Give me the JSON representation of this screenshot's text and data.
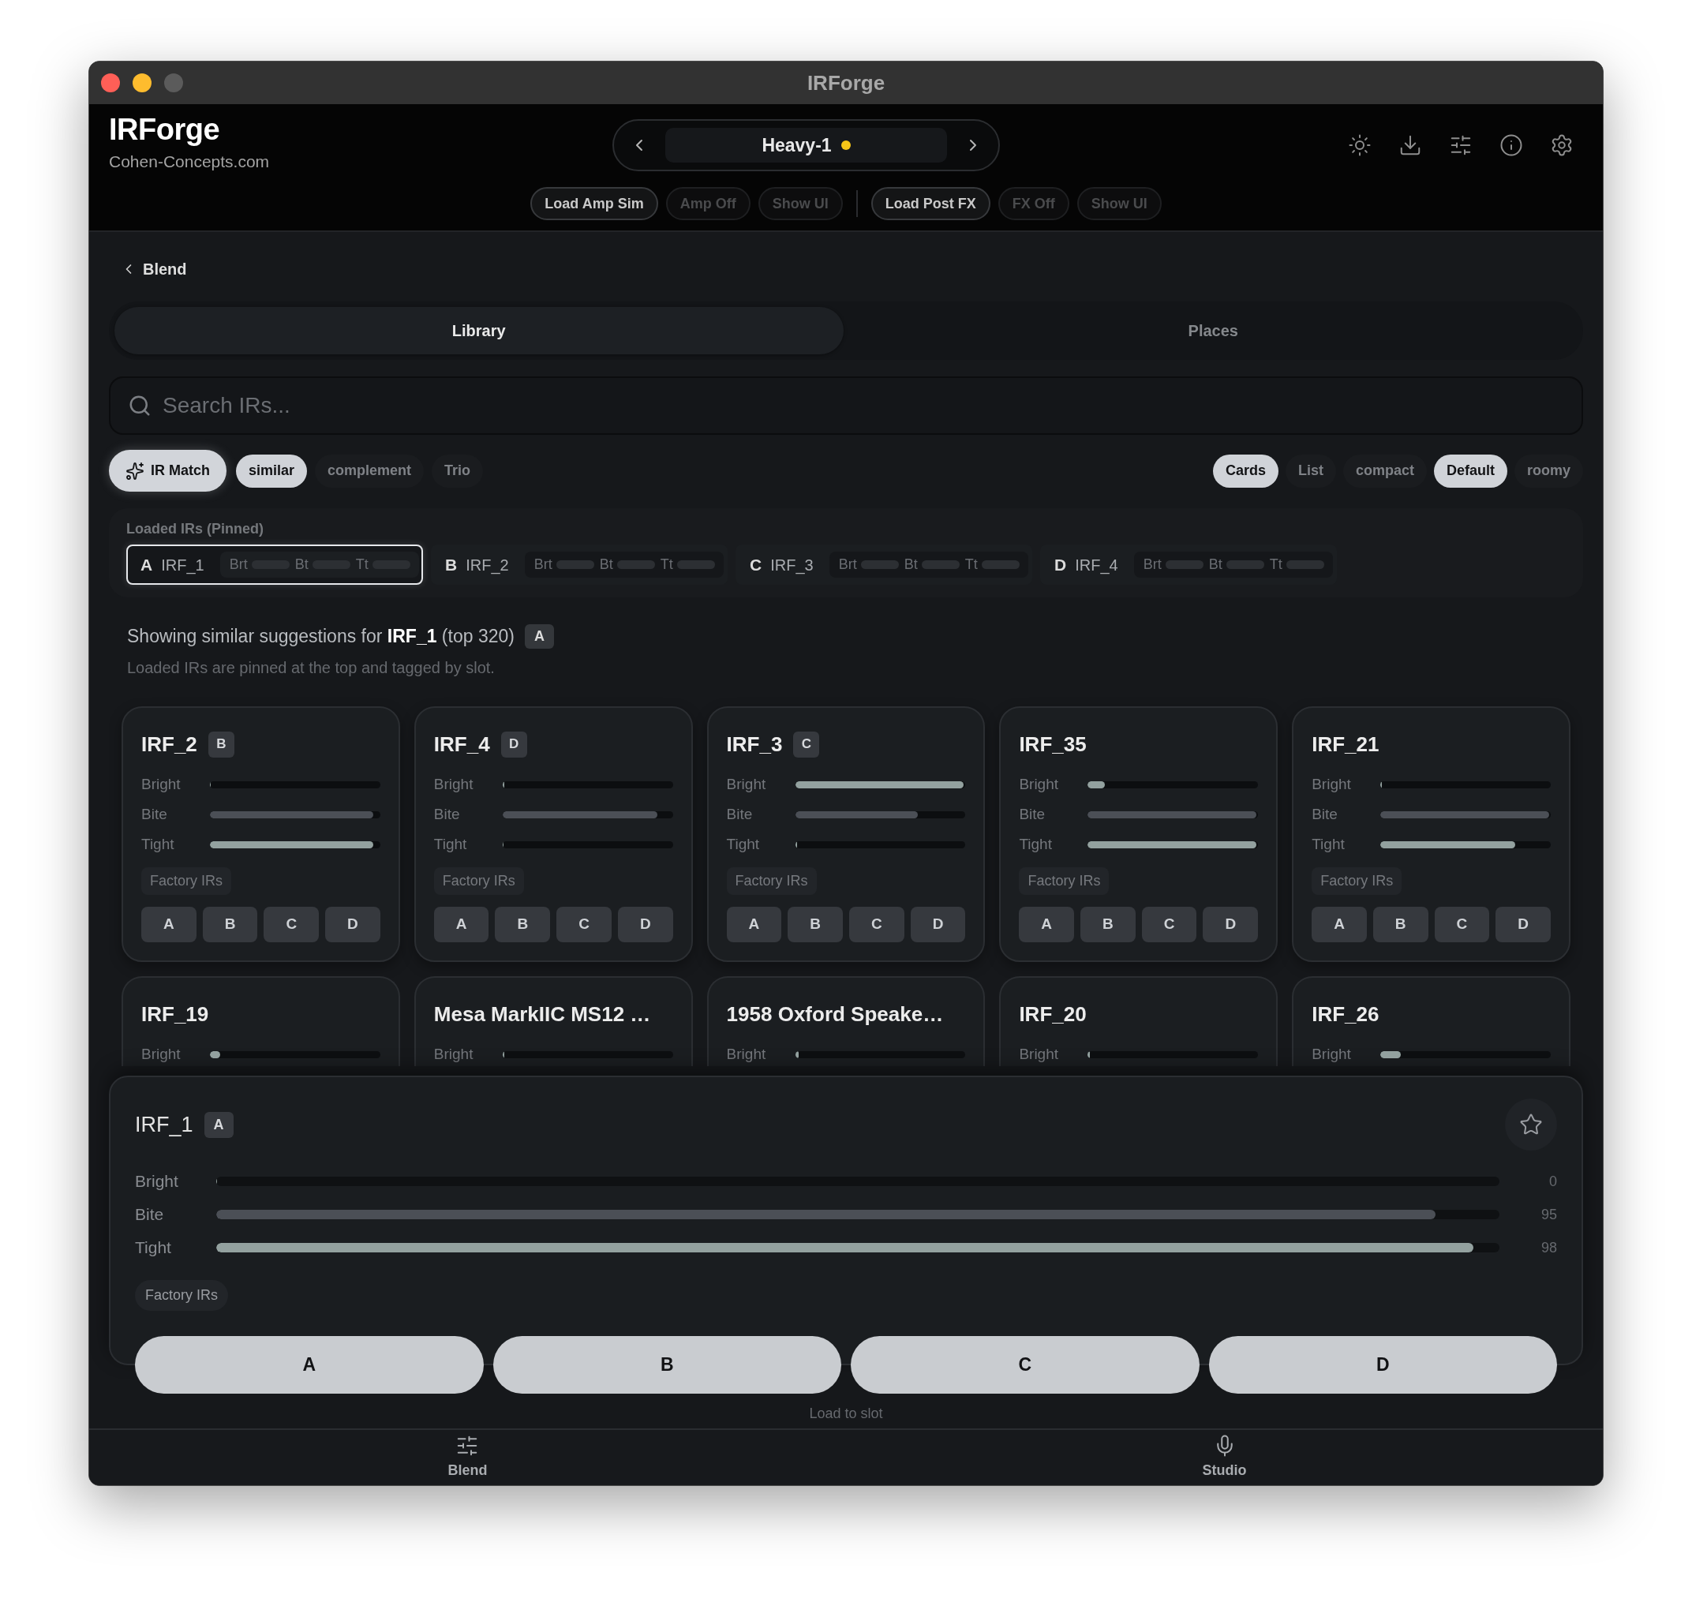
{
  "window": {
    "title": "IRForge"
  },
  "header": {
    "app_name": "IRForge",
    "site": "Cohen-Concepts.com",
    "preset": {
      "name": "Heavy-1",
      "modified": true
    },
    "action_groups": [
      {
        "actions": [
          {
            "label": "Load Amp Sim",
            "disabled": false
          },
          {
            "label": "Amp Off",
            "disabled": true
          },
          {
            "label": "Show UI",
            "disabled": true
          }
        ]
      },
      {
        "actions": [
          {
            "label": "Load Post FX",
            "disabled": false
          },
          {
            "label": "FX Off",
            "disabled": true
          },
          {
            "label": "Show UI",
            "disabled": true
          }
        ]
      }
    ]
  },
  "back": {
    "label": "Blend"
  },
  "tabs": [
    {
      "label": "Library",
      "selected": true
    },
    {
      "label": "Places",
      "selected": false
    }
  ],
  "search": {
    "placeholder": "Search IRs..."
  },
  "ir_match": {
    "label": "IR Match",
    "on": true
  },
  "match_modes": [
    {
      "label": "similar",
      "selected": true
    },
    {
      "label": "complement",
      "selected": false
    },
    {
      "label": "Trio",
      "selected": false
    }
  ],
  "view_modes": [
    {
      "label": "Cards",
      "selected": true
    },
    {
      "label": "List",
      "selected": false
    }
  ],
  "density": [
    {
      "label": "compact",
      "selected": false
    },
    {
      "label": "Default",
      "selected": true
    },
    {
      "label": "roomy",
      "selected": false
    }
  ],
  "pinned": {
    "title": "Loaded IRs (Pinned)",
    "items": [
      {
        "slot": "A",
        "name": "IRF_1",
        "selected": true,
        "meters": [
          "Brt",
          "Bt",
          "Tt"
        ]
      },
      {
        "slot": "B",
        "name": "IRF_2",
        "selected": false,
        "meters": [
          "Brt",
          "Bt",
          "Tt"
        ]
      },
      {
        "slot": "C",
        "name": "IRF_3",
        "selected": false,
        "meters": [
          "Brt",
          "Bt",
          "Tt"
        ]
      },
      {
        "slot": "D",
        "name": "IRF_4",
        "selected": false,
        "meters": [
          "Brt",
          "Bt",
          "Tt"
        ]
      }
    ]
  },
  "suggestions": {
    "summary": "Showing similar suggestions for **IRF_1** (top 320)",
    "slot_badge": "A",
    "note": "Loaded IRs are pinned at the top and tagged by slot."
  },
  "cards": [
    {
      "title": "IRF_2",
      "slot": "B",
      "bars": [
        {
          "label": "Bright",
          "level": 0
        },
        {
          "label": "Bite",
          "level": 0.96
        },
        {
          "label": "Tight",
          "level": 0.96
        }
      ],
      "tag": "Factory IRs",
      "slot_buttons": [
        "A",
        "B",
        "C",
        "D"
      ]
    },
    {
      "title": "IRF_4",
      "slot": "D",
      "bars": [
        {
          "label": "Bright",
          "level": 0.01
        },
        {
          "label": "Bite",
          "level": 0.91
        },
        {
          "label": "Tight",
          "level": 0
        }
      ],
      "tag": "Factory IRs",
      "slot_buttons": [
        "A",
        "B",
        "C",
        "D"
      ]
    },
    {
      "title": "IRF_3",
      "slot": "C",
      "bars": [
        {
          "label": "Bright",
          "level": 0.99
        },
        {
          "label": "Bite",
          "level": 0.72
        },
        {
          "label": "Tight",
          "level": 0.01
        }
      ],
      "tag": "Factory IRs",
      "slot_buttons": [
        "A",
        "B",
        "C",
        "D"
      ]
    },
    {
      "title": "IRF_35",
      "bars": [
        {
          "label": "Bright",
          "level": 0.1
        },
        {
          "label": "Bite",
          "level": 0.99
        },
        {
          "label": "Tight",
          "level": 0.99
        }
      ],
      "tag": "Factory IRs",
      "slot_buttons": [
        "A",
        "B",
        "C",
        "D"
      ]
    },
    {
      "title": "IRF_21",
      "bars": [
        {
          "label": "Bright",
          "level": 0.01
        },
        {
          "label": "Bite",
          "level": 0.99
        },
        {
          "label": "Tight",
          "level": 0.79
        }
      ],
      "tag": "Factory IRs",
      "slot_buttons": [
        "A",
        "B",
        "C",
        "D"
      ]
    },
    {
      "title": "IRF_19",
      "bars": [
        {
          "label": "Bright",
          "level": 0.06
        }
      ]
    },
    {
      "title": "Mesa MarkIIC MS12 …",
      "bars": [
        {
          "label": "Bright",
          "level": 0.01
        }
      ]
    },
    {
      "title": "1958 Oxford Speake…",
      "bars": [
        {
          "label": "Bright",
          "level": 0.02
        }
      ]
    },
    {
      "title": "IRF_20",
      "bars": [
        {
          "label": "Bright",
          "level": 0.01
        }
      ]
    },
    {
      "title": "IRF_26",
      "bars": [
        {
          "label": "Bright",
          "level": 0.12
        }
      ]
    }
  ],
  "detail": {
    "title": "IRF_1",
    "slot": "A",
    "favorite": false,
    "bars": [
      {
        "label": "Bright",
        "level": 0,
        "reading": "0"
      },
      {
        "label": "Bite",
        "level": 0.95,
        "reading": "95"
      },
      {
        "label": "Tight",
        "level": 0.98,
        "reading": "98"
      }
    ],
    "tag": "Factory IRs",
    "slot_buttons": [
      "A",
      "B",
      "C",
      "D"
    ],
    "caption": "Load to slot"
  },
  "bottom_nav": [
    {
      "label": "Blend",
      "selected": false
    },
    {
      "label": "Studio",
      "selected": false
    }
  ]
}
